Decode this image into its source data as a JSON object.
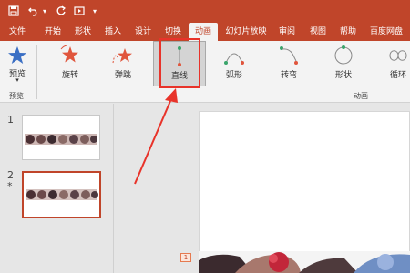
{
  "quick_access": {
    "save_icon": "save-icon",
    "undo_icon": "undo-icon",
    "undo_dropdown": "▾",
    "redo_icon": "redo-icon",
    "present_icon": "present-from-beginning-icon",
    "customize": "▾"
  },
  "tabs": [
    {
      "label": "文件"
    },
    {
      "label": "开始"
    },
    {
      "label": "形状"
    },
    {
      "label": "插入"
    },
    {
      "label": "设计"
    },
    {
      "label": "切换"
    },
    {
      "label": "动画",
      "active": true
    },
    {
      "label": "幻灯片放映"
    },
    {
      "label": "审阅"
    },
    {
      "label": "视图"
    },
    {
      "label": "帮助"
    },
    {
      "label": "百度网盘"
    }
  ],
  "ribbon": {
    "preview": {
      "label": "预览",
      "group_label": "预览"
    },
    "animation_group_label": "动画",
    "effects": [
      {
        "label": "旋转",
        "icon": "spin-star-icon"
      },
      {
        "label": "弹跳",
        "icon": "bounce-star-icon"
      },
      {
        "label": "直线",
        "icon": "line-path-icon",
        "selected": true
      },
      {
        "label": "弧形",
        "icon": "arc-path-icon"
      },
      {
        "label": "转弯",
        "icon": "turn-path-icon"
      },
      {
        "label": "形状",
        "icon": "shape-path-icon"
      },
      {
        "label": "循环",
        "icon": "loop-path-icon"
      }
    ]
  },
  "slides": [
    {
      "number": "1",
      "marker": ""
    },
    {
      "number": "2",
      "marker": "*",
      "selected": true
    }
  ],
  "canvas": {
    "animation_tag": "1"
  },
  "colors": {
    "brand": "#c0452a",
    "highlight": "#e8332a",
    "ribbon_bg": "#f3f3f3"
  }
}
